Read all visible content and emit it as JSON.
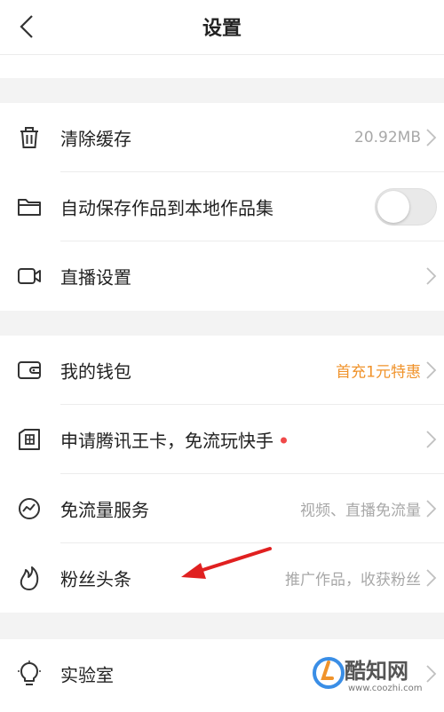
{
  "header": {
    "title": "设置",
    "back_icon": "back-chevron-icon"
  },
  "section1": [
    {
      "label": "清除缓存",
      "value": "20.92MB",
      "icon": "trash-icon"
    },
    {
      "label": "自动保存作品到本地作品集",
      "icon": "folder-icon",
      "toggle": "off"
    },
    {
      "label": "直播设置",
      "icon": "video-camera-icon"
    }
  ],
  "section2": [
    {
      "label": "我的钱包",
      "value": "首充1元特惠",
      "icon": "wallet-icon"
    },
    {
      "label": "申请腾讯王卡，免流玩快手",
      "icon": "card-icon"
    },
    {
      "label": "免流量服务",
      "value": "视频、直播免流量",
      "icon": "chart-circle-icon"
    },
    {
      "label": "粉丝头条",
      "value": "推广作品，收获粉丝",
      "icon": "flame-icon"
    }
  ],
  "section3": [
    {
      "label": "实验室",
      "icon": "lightbulb-icon"
    }
  ],
  "watermark": {
    "name": "酷知网",
    "url": "www.coozhi.com"
  },
  "colors": {
    "accent_orange": "#f0932b",
    "red_dot": "#f04848",
    "annotation_arrow": "#e02020",
    "divider_bg": "#f3f3f3"
  }
}
